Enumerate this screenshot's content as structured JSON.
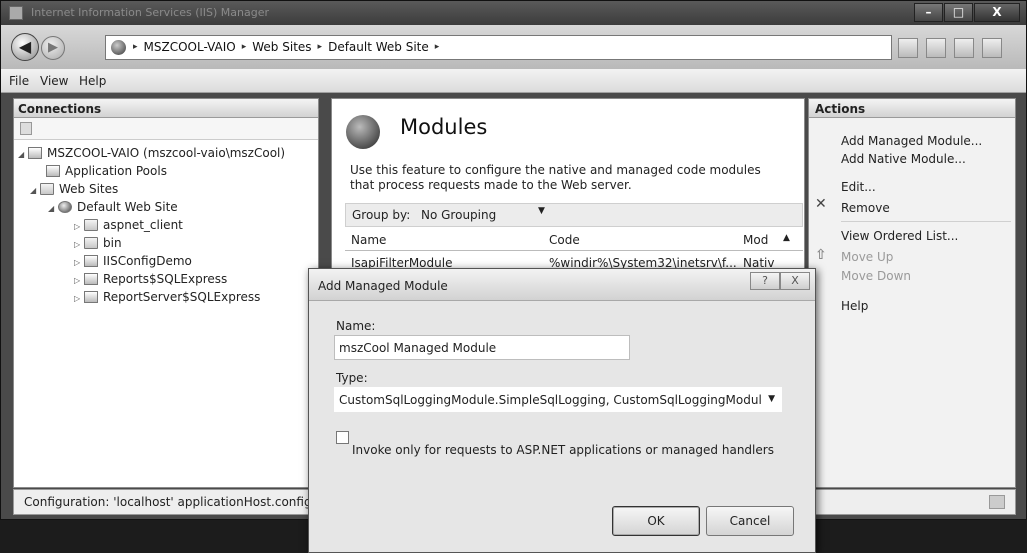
{
  "window": {
    "title": "Internet Information Services (IIS) Manager",
    "controls": {
      "minimize": "–",
      "maximize": "□",
      "close": "X"
    }
  },
  "nav": {
    "back_icon": "arrow-left-icon",
    "forward_icon": "arrow-right-icon",
    "breadcrumbs": [
      "MSZCOOL-VAIO",
      "Web Sites",
      "Default Web Site"
    ],
    "separator": "▸"
  },
  "menu": {
    "file": "File",
    "view": "View",
    "help": "Help"
  },
  "connections": {
    "title": "Connections",
    "tree": {
      "server": "MSZCOOL-VAIO (mszcool-vaio\\mszCool)",
      "app_pools": "Application Pools",
      "web_sites": "Web Sites",
      "default_site": "Default Web Site",
      "children": [
        "aspnet_client",
        "bin",
        "IISConfigDemo",
        "Reports$SQLExpress",
        "ReportServer$SQLExpress"
      ]
    }
  },
  "main": {
    "title": "Modules",
    "description": "Use this feature to configure the native and managed code modules that process requests made to the Web server.",
    "group_by_label": "Group by:",
    "group_by_value": "No Grouping",
    "columns": [
      "Name",
      "Code",
      "Mod"
    ],
    "rows": [
      {
        "name": "IsapiFilterModule",
        "code": "%windir%\\System32\\inetsrv\\f...",
        "mod": "Nativ"
      }
    ]
  },
  "actions": {
    "title": "Actions",
    "items": [
      {
        "label": "Add Managed Module...",
        "enabled": true
      },
      {
        "label": "Add Native Module...",
        "enabled": true
      },
      {
        "label": "Edit...",
        "enabled": true
      },
      {
        "label": "Remove",
        "enabled": true
      },
      {
        "label": "View Ordered List...",
        "enabled": true
      },
      {
        "label": "Move Up",
        "enabled": false
      },
      {
        "label": "Move Down",
        "enabled": false
      },
      {
        "label": "Help",
        "enabled": true
      }
    ]
  },
  "status": {
    "text": "Configuration: 'localhost' applicationHost.config or"
  },
  "dialog": {
    "title": "Add Managed Module",
    "help_button": "?",
    "close_button": "X",
    "name_label": "Name:",
    "name_value": "mszCool Managed Module",
    "type_label": "Type:",
    "type_value": "CustomSqlLoggingModule.SimpleSqlLogging, CustomSqlLoggingModul",
    "checkbox_label": "Invoke only for requests to ASP.NET applications or managed handlers",
    "checkbox_checked": false,
    "ok": "OK",
    "cancel": "Cancel"
  }
}
